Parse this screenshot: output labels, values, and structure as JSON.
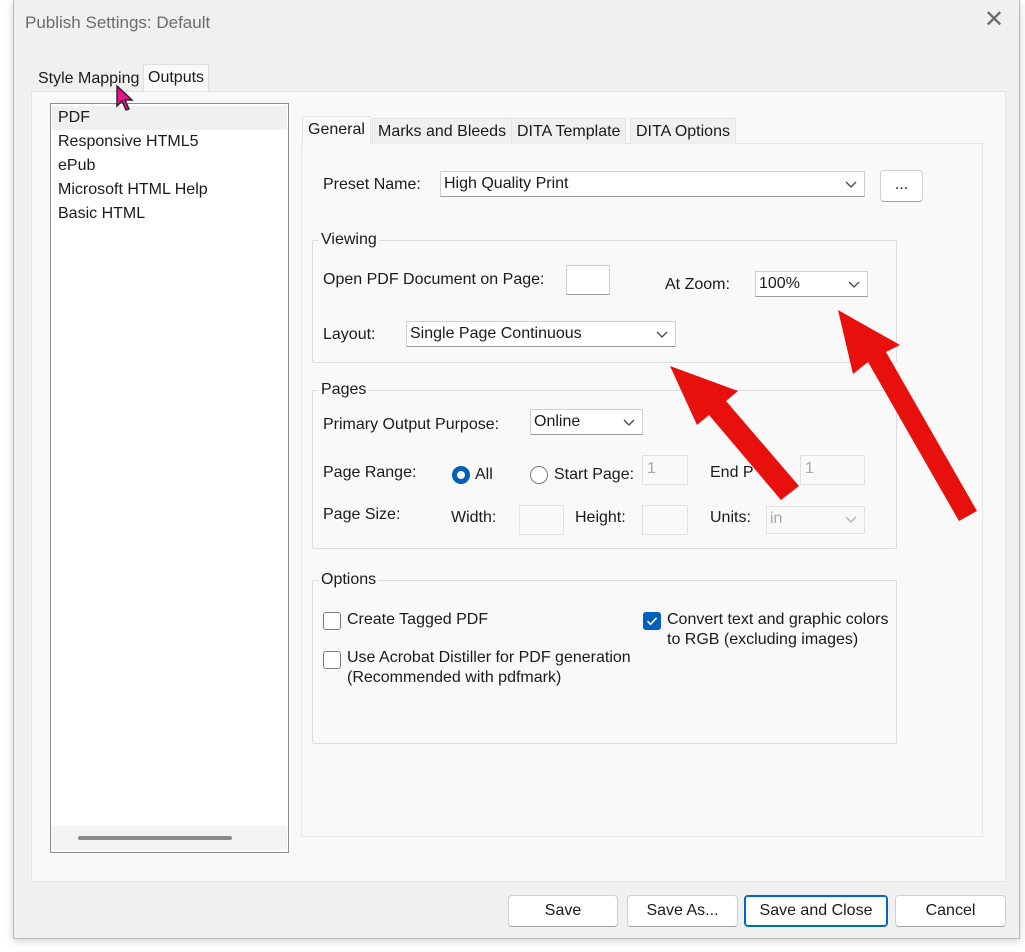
{
  "window": {
    "title": "Publish Settings: Default",
    "close_icon": "close-icon"
  },
  "top_tabs": [
    {
      "label": "Style Mapping"
    },
    {
      "label": "Outputs"
    }
  ],
  "outputs_list": [
    "PDF",
    "Responsive HTML5",
    "ePub",
    "Microsoft HTML Help",
    "Basic HTML"
  ],
  "inner_tabs": [
    {
      "label": "General"
    },
    {
      "label": "Marks and Bleeds"
    },
    {
      "label": "DITA Template"
    },
    {
      "label": "DITA Options"
    }
  ],
  "general": {
    "preset_label": "Preset Name:",
    "preset_value": "High Quality Print",
    "browse_label": "...",
    "viewing": {
      "title": "Viewing",
      "open_page_label": "Open PDF Document on Page:",
      "open_page_value": "",
      "zoom_label": "At Zoom:",
      "zoom_value": "100%",
      "layout_label": "Layout:",
      "layout_value": "Single Page Continuous"
    },
    "pages": {
      "title": "Pages",
      "purpose_label": "Primary Output Purpose:",
      "purpose_value": "Online",
      "range_label": "Page Range:",
      "all_label": "All",
      "start_label": "Start Page:",
      "start_value": "1",
      "end_label": "End P",
      "end_value": "1",
      "size_label": "Page Size:",
      "width_label": "Width:",
      "height_label": "Height:",
      "units_label": "Units:",
      "units_value": "in"
    },
    "options": {
      "title": "Options",
      "tagged_pdf": {
        "label": "Create Tagged PDF",
        "checked": false
      },
      "distiller": {
        "label_line1": "Use Acrobat Distiller for PDF generation",
        "label_line2": "(Recommended with pdfmark)",
        "checked": false
      },
      "rgb": {
        "label_line1": "Convert text and graphic colors",
        "label_line2": "to RGB (excluding images)",
        "checked": true
      }
    }
  },
  "buttons": {
    "save": "Save",
    "save_as": "Save As...",
    "save_close": "Save and Close",
    "cancel": "Cancel"
  },
  "colors": {
    "accent": "#005fb8",
    "annotation_arrow": "#e8100c",
    "cursor": "#e0148c"
  }
}
